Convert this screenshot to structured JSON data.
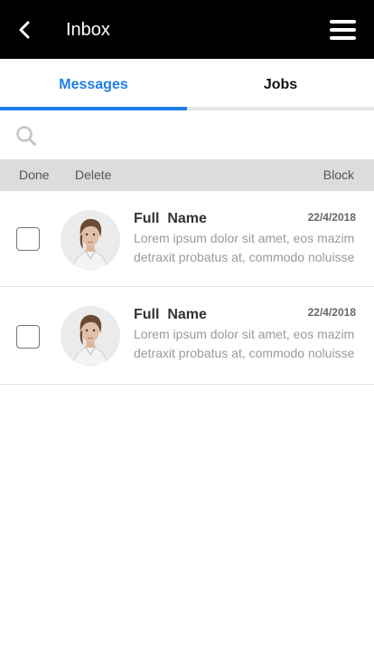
{
  "header": {
    "title": "Inbox",
    "back_icon": "chevron-left-icon",
    "menu_icon": "hamburger-menu-icon",
    "background": "#000000"
  },
  "tabs": [
    {
      "label": "Messages",
      "active": true
    },
    {
      "label": "Jobs",
      "active": false
    }
  ],
  "colors": {
    "accent": "#1e7ee6",
    "muted_text": "#9a9a9a"
  },
  "search": {
    "placeholder": "",
    "value": "",
    "icon": "search-icon"
  },
  "actions": {
    "done": "Done",
    "delete": "Delete",
    "block": "Block"
  },
  "messages": [
    {
      "name": "Full  Name",
      "date": "22/4/2018",
      "line1": "Lorem ipsum dolor sit amet, eos mazim",
      "line2": "detraxit probatus at, commodo noluisse",
      "checked": false
    },
    {
      "name": "Full  Name",
      "date": "22/4/2018",
      "line1": "Lorem ipsum dolor sit amet, eos mazim",
      "line2": "detraxit probatus at, commodo noluisse",
      "checked": false
    }
  ]
}
